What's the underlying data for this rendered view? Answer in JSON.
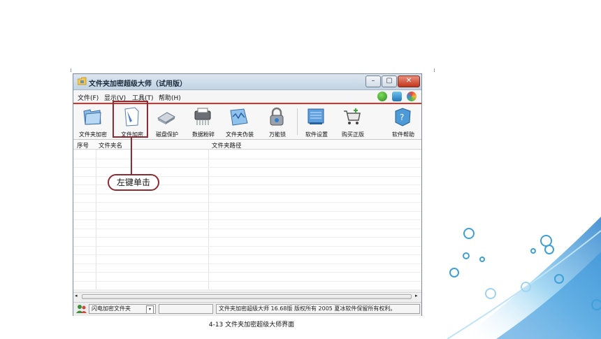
{
  "window": {
    "title": "文件夹加密超级大师（试用版）",
    "controls": {
      "minimize": "–",
      "maximize": "▢",
      "close": "✕"
    }
  },
  "menu": {
    "items": [
      "文件(F)",
      "显示(V)",
      "工具(T)",
      "帮助(H)"
    ],
    "right_icons": [
      "shield-icon",
      "phone-icon",
      "colorful-ball-icon"
    ]
  },
  "toolbar": {
    "buttons": [
      {
        "label": "文件夹加密",
        "icon": "folder-icon"
      },
      {
        "label": "文件加密",
        "icon": "document-icon"
      },
      {
        "label": "磁盘保护",
        "icon": "disk-icon"
      },
      {
        "label": "数据粉碎",
        "icon": "shredder-icon"
      },
      {
        "label": "文件夹伪装",
        "icon": "folder-disguise-icon"
      },
      {
        "label": "万能锁",
        "icon": "padlock-icon"
      },
      {
        "label": "软件设置",
        "icon": "settings-icon"
      },
      {
        "label": "购买正版",
        "icon": "cart-icon"
      },
      {
        "label": "软件帮助",
        "icon": "help-icon"
      }
    ]
  },
  "list": {
    "columns": [
      "序号",
      "文件夹名",
      "文件夹路径"
    ],
    "rows": []
  },
  "status": {
    "dropdown": "闪电加密文件夹",
    "empty_field": "",
    "copyright": "文件夹加密超级大师 16.68版 版权所有 2005 夏冰软件保留所有权利。"
  },
  "annotation": {
    "callout": "左键单击"
  },
  "caption": "4-13  文件夹加密超级大师界面",
  "colors": {
    "accent_red": "#d9322a",
    "annotation": "#8c2b32",
    "bubble_blue": "#3ea0d8"
  }
}
